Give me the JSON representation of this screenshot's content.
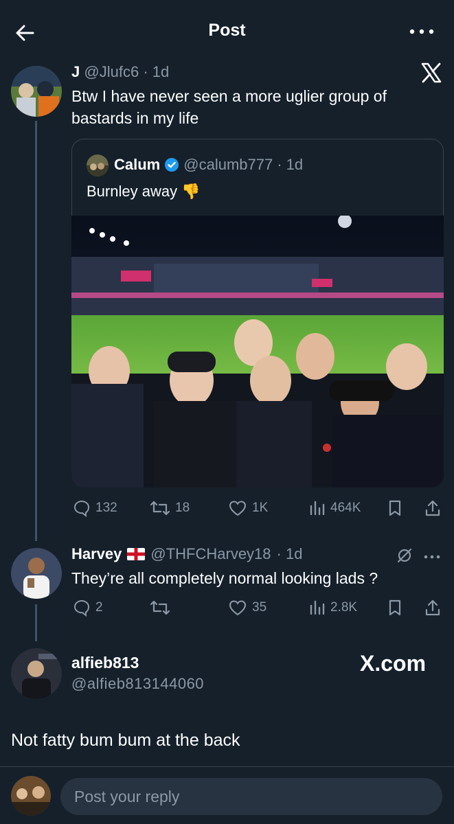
{
  "header": {
    "title": "Post"
  },
  "main_post": {
    "name": "J",
    "handle": "@Jlufc6",
    "time": "· 1d",
    "text": "Btw I have never seen a more uglier group of bastards in my life"
  },
  "quoted_post": {
    "name": "Calum",
    "handle": "@calumb777",
    "time": "· 1d",
    "text": "Burnley away",
    "emoji": "👎",
    "stats": {
      "replies": "132",
      "reposts": "18",
      "likes": "1K",
      "views": "464K"
    }
  },
  "reply": {
    "name": "Harvey",
    "handle": "@THFCHarvey18",
    "time": "· 1d",
    "text": "They’re all completely normal looking lads ?",
    "stats": {
      "replies": "2",
      "likes": "35",
      "views": "2.8K"
    }
  },
  "embed_user": {
    "name": "alfieb813",
    "handle": "@alfieb813144060",
    "watermark": "X.com"
  },
  "comment": {
    "text": "Not fatty bum bum at the back"
  },
  "reply_bar": {
    "placeholder": "Post your reply"
  },
  "colors": {
    "background": "#15202b",
    "accent": "#1d9bf0",
    "muted": "#8b98a5"
  }
}
